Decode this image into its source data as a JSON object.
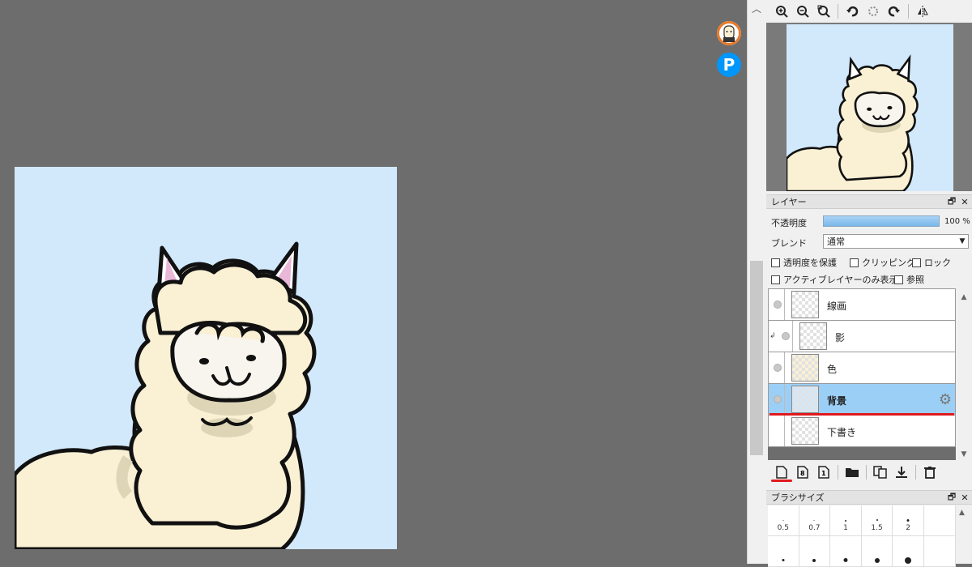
{
  "navigator": {
    "tools": [
      "zoom-in-icon",
      "zoom-out-icon",
      "zoom-fit-icon",
      "rotate-left-icon",
      "rotate-reset-icon",
      "rotate-right-icon",
      "flip-horizontal-icon"
    ]
  },
  "layer_panel": {
    "title": "レイヤー",
    "opacity_label": "不透明度",
    "opacity_value": "100 %",
    "opacity_fraction": 1.0,
    "blend_label": "ブレンド",
    "blend_value": "通常",
    "options": {
      "protect_alpha": "透明度を保護",
      "clipping": "クリッピング",
      "lock": "ロック",
      "active_only": "アクティブレイヤーのみ表示",
      "reference": "参照"
    },
    "layers": [
      {
        "name": "線画",
        "selected": false,
        "clipped": false
      },
      {
        "name": "影",
        "selected": false,
        "clipped": true
      },
      {
        "name": "色",
        "selected": false,
        "clipped": false
      },
      {
        "name": "背景",
        "selected": true,
        "clipped": false
      },
      {
        "name": "下書き",
        "selected": false,
        "clipped": false
      }
    ]
  },
  "brush_panel": {
    "title": "ブラシサイズ",
    "sizes": [
      "0.5",
      "0.7",
      "1",
      "1.5",
      "2"
    ]
  },
  "colors": {
    "canvas_bg": "#d2e8fb",
    "alpaca_wool": "#faf0d4",
    "selection": "#9ccff6",
    "highlight_red": "#e0191e"
  }
}
